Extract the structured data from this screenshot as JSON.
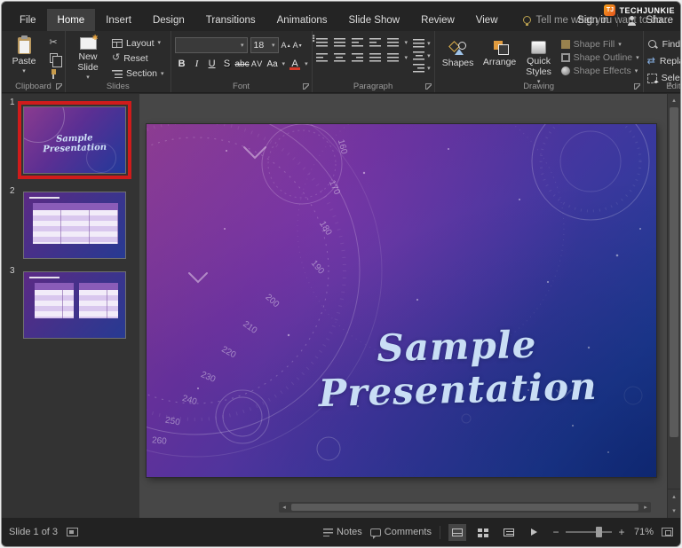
{
  "brand": {
    "logo": "TJ",
    "name": "TECHJUNKIE"
  },
  "titlebar": {
    "tabs": [
      "File",
      "Home",
      "Insert",
      "Design",
      "Transitions",
      "Animations",
      "Slide Show",
      "Review",
      "View"
    ],
    "active_tab": "Home",
    "tell_me": "Tell me what you want to do...",
    "sign_in": "Sign in",
    "share": "Share"
  },
  "ribbon": {
    "clipboard": {
      "group_label": "Clipboard",
      "paste_label": "Paste"
    },
    "slides": {
      "group_label": "Slides",
      "new_slide_label": "New Slide",
      "layout_label": "Layout",
      "reset_label": "Reset",
      "section_label": "Section"
    },
    "font": {
      "group_label": "Font",
      "font_name_value": "",
      "font_size_value": "18",
      "bold": "B",
      "italic": "I",
      "underline": "U",
      "shadow": "S",
      "strikethrough": "abc",
      "char_spacing": "AV",
      "change_case": "Aa",
      "font_color": "A"
    },
    "paragraph": {
      "group_label": "Paragraph"
    },
    "drawing": {
      "group_label": "Drawing",
      "shapes_label": "Shapes",
      "arrange_label": "Arrange",
      "quick_styles_label": "Quick Styles",
      "shape_fill_label": "Shape Fill",
      "shape_outline_label": "Shape Outline",
      "shape_effects_label": "Shape Effects"
    },
    "editing": {
      "group_label": "Editing",
      "find_label": "Find",
      "replace_label": "Replace",
      "select_label": "Select"
    }
  },
  "slide_panel": {
    "thumbnails": [
      {
        "number": "1",
        "selected": true,
        "title": "Sample Presentation"
      },
      {
        "number": "2",
        "selected": false
      },
      {
        "number": "3",
        "selected": false
      }
    ]
  },
  "canvas": {
    "slide_title": "Sample Presentation",
    "gauge_numbers": [
      "160",
      "170",
      "180",
      "190",
      "200",
      "210",
      "220",
      "230",
      "240",
      "250",
      "260"
    ]
  },
  "status_bar": {
    "slide_indicator": "Slide 1 of 3",
    "notes_label": "Notes",
    "comments_label": "Comments",
    "zoom_value": "71%"
  },
  "colors": {
    "annotation_red": "#d01b1b",
    "slide_gradient_start": "#8a3b8f",
    "slide_gradient_end": "#16368c",
    "title_text": "#c9def5"
  }
}
